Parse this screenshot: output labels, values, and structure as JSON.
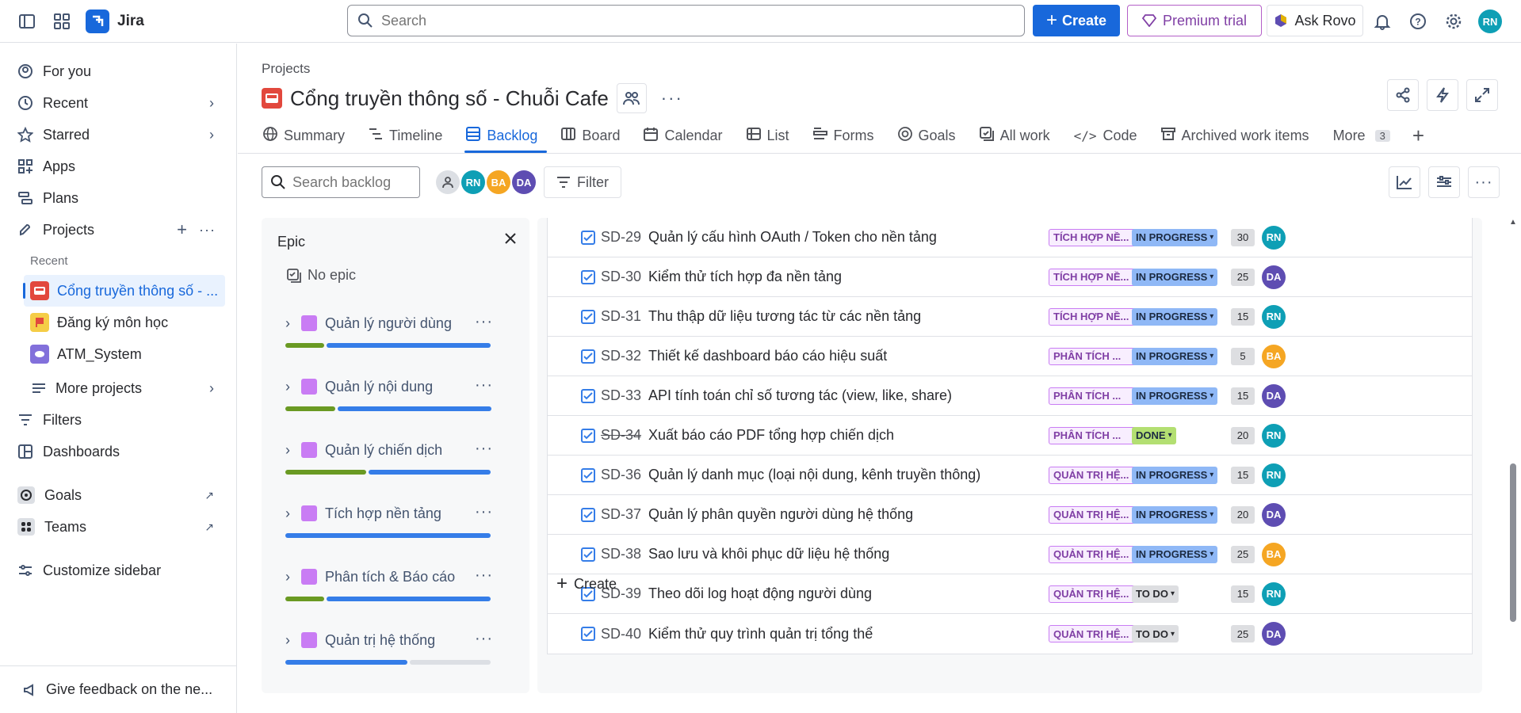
{
  "app": {
    "name": "Jira"
  },
  "topbar": {
    "search_placeholder": "Search",
    "create_label": "Create",
    "premium_label": "Premium trial",
    "rovo_label": "Ask Rovo",
    "user_initials": "RN"
  },
  "sidebar": {
    "for_you": "For you",
    "recent": "Recent",
    "starred": "Starred",
    "apps": "Apps",
    "plans": "Plans",
    "projects": "Projects",
    "recent_sub": "Recent",
    "projects_list": [
      {
        "name": "Cổng truyền thông số - ..."
      },
      {
        "name": "Đăng ký môn học"
      },
      {
        "name": "ATM_System"
      }
    ],
    "more_projects": "More projects",
    "filters": "Filters",
    "dashboards": "Dashboards",
    "goals": "Goals",
    "teams": "Teams",
    "customize": "Customize sidebar",
    "feedback": "Give feedback on the ne..."
  },
  "header": {
    "breadcrumb": "Projects",
    "title": "Cổng truyền thông số - Chuỗi Cafe"
  },
  "tabs": [
    {
      "label": "Summary"
    },
    {
      "label": "Timeline"
    },
    {
      "label": "Backlog"
    },
    {
      "label": "Board"
    },
    {
      "label": "Calendar"
    },
    {
      "label": "List"
    },
    {
      "label": "Forms"
    },
    {
      "label": "Goals"
    },
    {
      "label": "All work"
    },
    {
      "label": "Code"
    },
    {
      "label": "Archived work items"
    },
    {
      "label": "More"
    }
  ],
  "more_count": "3",
  "toolbar": {
    "search_placeholder": "Search backlog",
    "filter_label": "Filter",
    "avatars": [
      {
        "initials": "RN",
        "color": "#0e9fb5"
      },
      {
        "initials": "BA",
        "color": "#f5a623"
      },
      {
        "initials": "DA",
        "color": "#5e4db2"
      }
    ]
  },
  "epic_panel": {
    "title": "Epic",
    "no_epic": "No epic",
    "epics": [
      {
        "name": "Quản lý người dùng",
        "progress": [
          0.2,
          0.8,
          0
        ]
      },
      {
        "name": "Quản lý nội dung",
        "progress": [
          0.25,
          0.75,
          0
        ]
      },
      {
        "name": "Quản lý chiến dịch",
        "progress": [
          0.4,
          0.6,
          0
        ]
      },
      {
        "name": "Tích hợp nền tảng",
        "progress": [
          0,
          1,
          0
        ]
      },
      {
        "name": "Phân tích & Báo cáo",
        "progress": [
          0.2,
          0.8,
          0
        ]
      },
      {
        "name": "Quản trị hệ thống",
        "progress": [
          0,
          0.6,
          0.4
        ]
      }
    ]
  },
  "work_items": [
    {
      "key": "SD-29",
      "summary": "Quản lý cấu hình OAuth / Token cho nền tảng",
      "epic": "TÍCH HỢP NỀ...",
      "status": "IN PROGRESS",
      "status_type": "inprog",
      "estimate": "30",
      "assignee": "RN",
      "assignee_color": "#0e9fb5",
      "done": false
    },
    {
      "key": "SD-30",
      "summary": "Kiểm thử tích hợp đa nền tảng",
      "epic": "TÍCH HỢP NỀ...",
      "status": "IN PROGRESS",
      "status_type": "inprog",
      "estimate": "25",
      "assignee": "DA",
      "assignee_color": "#5e4db2",
      "done": false
    },
    {
      "key": "SD-31",
      "summary": "Thu thập dữ liệu tương tác từ các nền tảng",
      "epic": "TÍCH HỢP NỀ...",
      "status": "IN PROGRESS",
      "status_type": "inprog",
      "estimate": "15",
      "assignee": "RN",
      "assignee_color": "#0e9fb5",
      "done": false
    },
    {
      "key": "SD-32",
      "summary": "Thiết kế dashboard báo cáo hiệu suất",
      "epic": "PHÂN TÍCH ...",
      "status": "IN PROGRESS",
      "status_type": "inprog",
      "estimate": "5",
      "assignee": "BA",
      "assignee_color": "#f5a623",
      "done": false
    },
    {
      "key": "SD-33",
      "summary": "API tính toán chỉ số tương tác (view, like, share)",
      "epic": "PHÂN TÍCH ...",
      "status": "IN PROGRESS",
      "status_type": "inprog",
      "estimate": "15",
      "assignee": "DA",
      "assignee_color": "#5e4db2",
      "done": false
    },
    {
      "key": "SD-34",
      "summary": "Xuất báo cáo PDF tổng hợp chiến dịch",
      "epic": "PHÂN TÍCH ...",
      "status": "DONE",
      "status_type": "done",
      "estimate": "20",
      "assignee": "RN",
      "assignee_color": "#0e9fb5",
      "done": true
    },
    {
      "key": "SD-36",
      "summary": "Quản lý danh mục (loại nội dung, kênh truyền thông)",
      "epic": "QUẢN TRỊ HỆ...",
      "status": "IN PROGRESS",
      "status_type": "inprog",
      "estimate": "15",
      "assignee": "RN",
      "assignee_color": "#0e9fb5",
      "done": false
    },
    {
      "key": "SD-37",
      "summary": "Quản lý phân quyền người dùng hệ thống",
      "epic": "QUẢN TRỊ HỆ...",
      "status": "IN PROGRESS",
      "status_type": "inprog",
      "estimate": "20",
      "assignee": "DA",
      "assignee_color": "#5e4db2",
      "done": false
    },
    {
      "key": "SD-38",
      "summary": "Sao lưu và khôi phục dữ liệu hệ thống",
      "epic": "QUẢN TRỊ HỆ...",
      "status": "IN PROGRESS",
      "status_type": "inprog",
      "estimate": "25",
      "assignee": "BA",
      "assignee_color": "#f5a623",
      "done": false
    },
    {
      "key": "SD-39",
      "summary": "Theo dõi log hoạt động người dùng",
      "epic": "QUẢN TRỊ HỆ...",
      "status": "TO DO",
      "status_type": "todo",
      "estimate": "15",
      "assignee": "RN",
      "assignee_color": "#0e9fb5",
      "done": false
    },
    {
      "key": "SD-40",
      "summary": "Kiểm thử quy trình quản trị tổng thể",
      "epic": "QUẢN TRỊ HỆ...",
      "status": "TO DO",
      "status_type": "todo",
      "estimate": "25",
      "assignee": "DA",
      "assignee_color": "#5e4db2",
      "done": false
    }
  ],
  "create_row_label": "Create",
  "colors": {
    "brand": "#1868db",
    "premium": "#803fa5",
    "epic": "#c97cf4"
  }
}
